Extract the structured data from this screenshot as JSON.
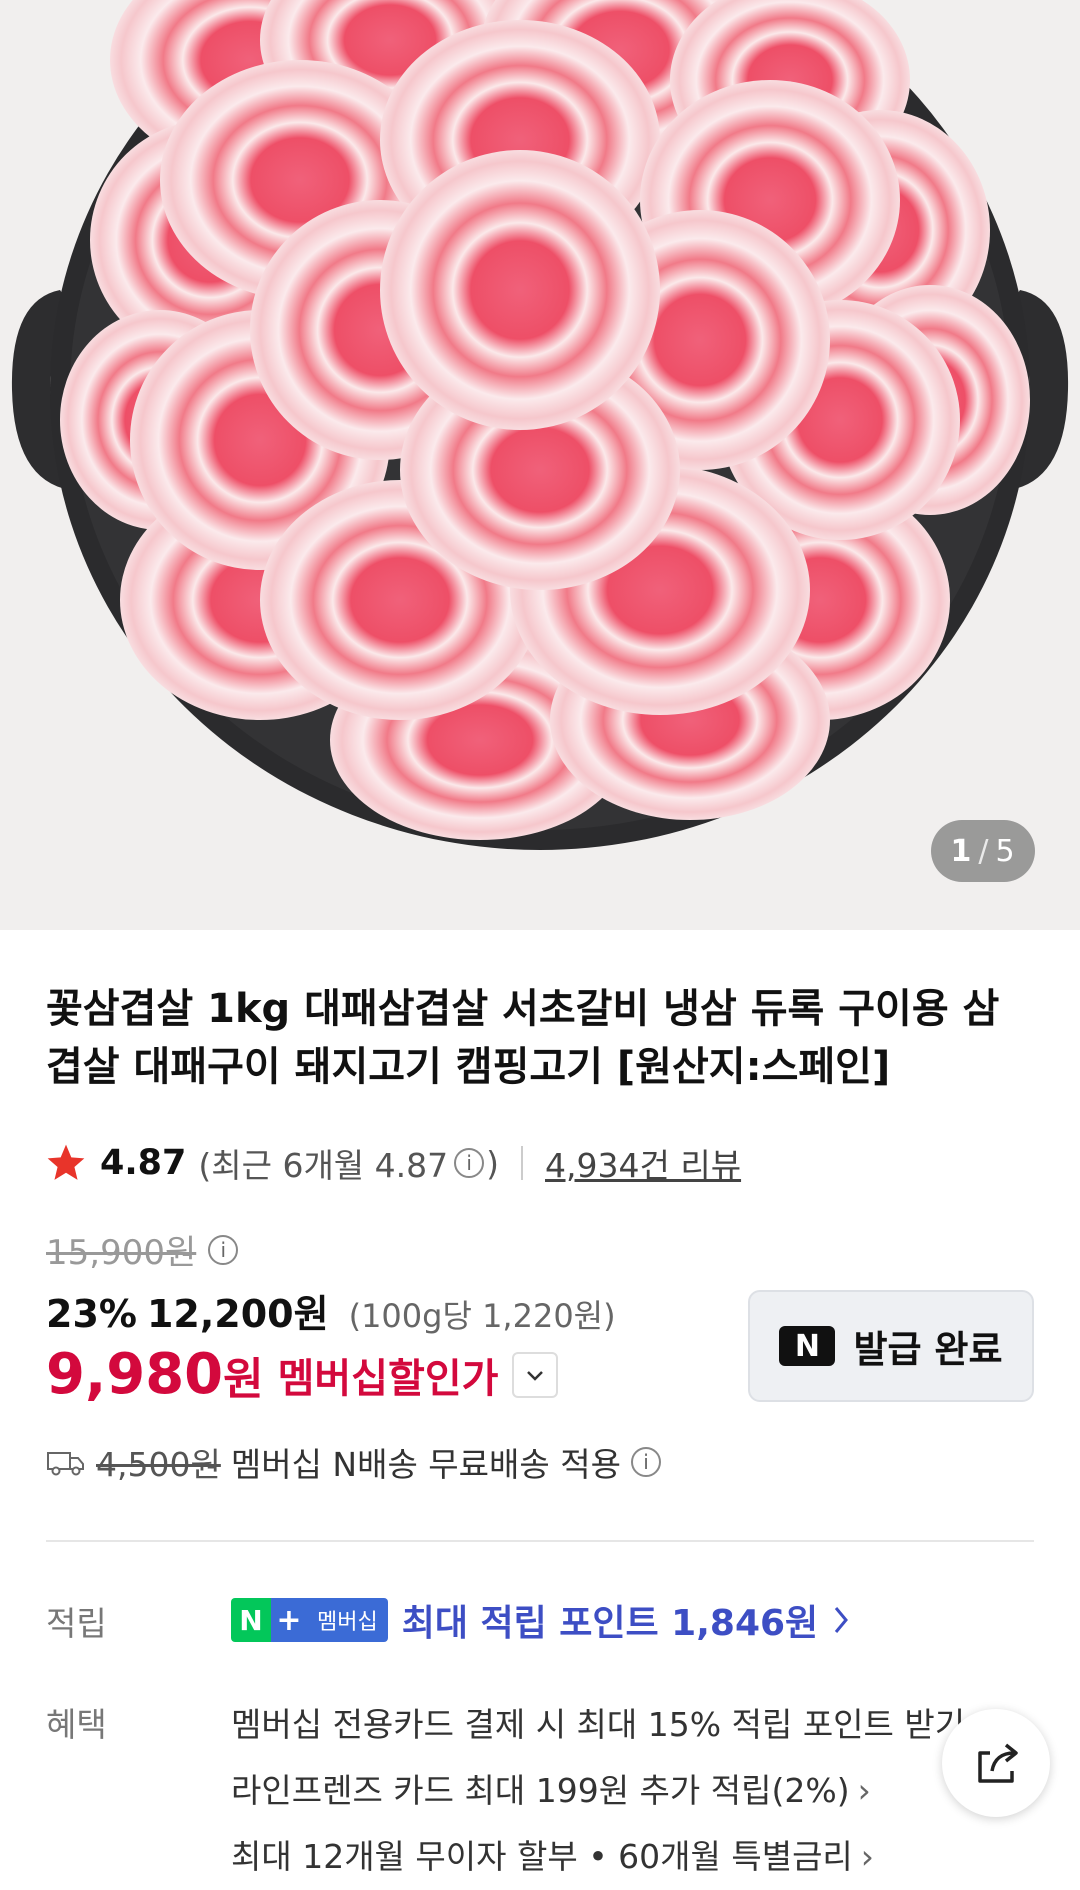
{
  "hero": {
    "current": "1",
    "separator": "/",
    "total": "5"
  },
  "product": {
    "title": "꽃삼겹살 1kg 대패삼겹살 서초갈비 냉삼 듀록 구이용 삼겹살 대패구이 돼지고기 캠핑고기 [원산지:스페인]",
    "rating": "4.87",
    "recent_rating": "(최근 6개월 4.87",
    "recent_close": ")",
    "reviews": "4,934건 리뷰"
  },
  "price": {
    "original": "15,900원",
    "discount_pct": "23%",
    "sale_price": "12,200원",
    "unit_price": "(100g당 1,220원)",
    "member_price": "9,980",
    "member_won": "원",
    "member_label": "멤버십할인가"
  },
  "coupon_button": {
    "logo": "N",
    "label": "발급 완료"
  },
  "shipping": {
    "fee": "4,500원",
    "text": "멤버십 N배송 무료배송 적용"
  },
  "points": {
    "label": "적립",
    "badge_n": "N",
    "badge_plus": "+",
    "badge_membership": "멤버십",
    "text": "최대 적립 포인트 1,846원"
  },
  "benefits": {
    "label": "혜택",
    "items": [
      "멤버십 전용카드 결제 시 최대 15% 적립 포인트 받기",
      "라인프렌즈 카드 최대 199원 추가 적립(2%)",
      "최대 12개월 무이자 할부 • 60개월 특별금리"
    ]
  },
  "icons": {
    "star": "star-icon",
    "info": "info-icon",
    "truck": "truck-icon",
    "chevron": "chevron-right-icon",
    "share": "share-icon"
  },
  "colors": {
    "member_red": "#d3093d",
    "points_blue": "#3d4ec4",
    "naver_green": "#03c75a",
    "star_red": "#e8342a"
  }
}
